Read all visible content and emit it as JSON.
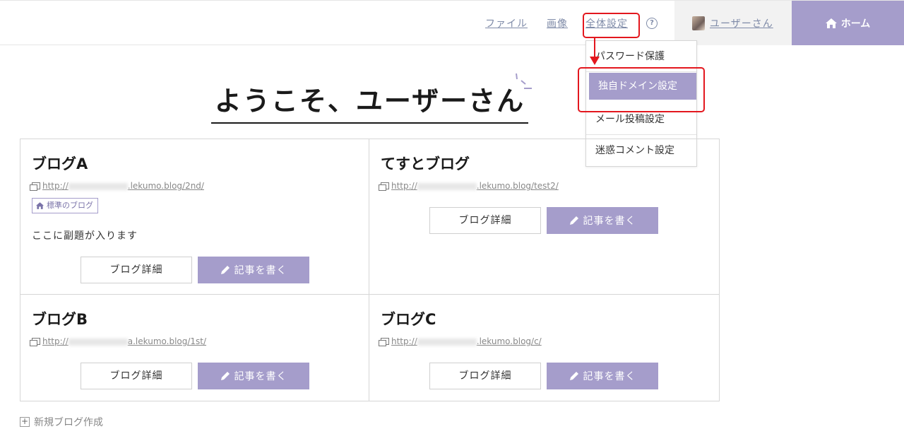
{
  "header": {
    "nav": [
      {
        "label": "ファイル"
      },
      {
        "label": "画像"
      },
      {
        "label": "全体設定"
      }
    ],
    "help_glyph": "?",
    "user_name": "ユーザーさん",
    "home_label": "ホーム"
  },
  "settings_menu": {
    "items": [
      {
        "label": "パスワード保護"
      },
      {
        "label": "独自ドメイン設定"
      },
      {
        "label": "メール投稿設定"
      },
      {
        "label": "迷惑コメント設定"
      }
    ],
    "active_index": 1
  },
  "welcome": "ようこそ、ユーザーさん",
  "blogs": [
    {
      "title": "ブログA",
      "url_prefix": "http://",
      "url_suffix": ".lekumo.blog/2nd/",
      "badge": "標準のブログ",
      "subtitle": "ここに副題が入ります",
      "detail_label": "ブログ詳細",
      "write_label": "記事を書く"
    },
    {
      "title": "てすとブログ",
      "url_prefix": "http://",
      "url_suffix": ".lekumo.blog/test2/",
      "detail_label": "ブログ詳細",
      "write_label": "記事を書く"
    },
    {
      "title": "ブログB",
      "url_prefix": "http://",
      "url_suffix": "a.lekumo.blog/1st/",
      "detail_label": "ブログ詳細",
      "write_label": "記事を書く"
    },
    {
      "title": "ブログC",
      "url_prefix": "http://",
      "url_suffix": ".lekumo.blog/c/",
      "detail_label": "ブログ詳細",
      "write_label": "記事を書く"
    }
  ],
  "new_blog_label": "新規ブログ作成",
  "colors": {
    "accent": "#a59dcb",
    "link": "#7f8ba8",
    "highlight": "#e3171e"
  },
  "icons": [
    "home-icon",
    "help-icon",
    "pencil-icon",
    "link-icon",
    "plus-icon"
  ]
}
